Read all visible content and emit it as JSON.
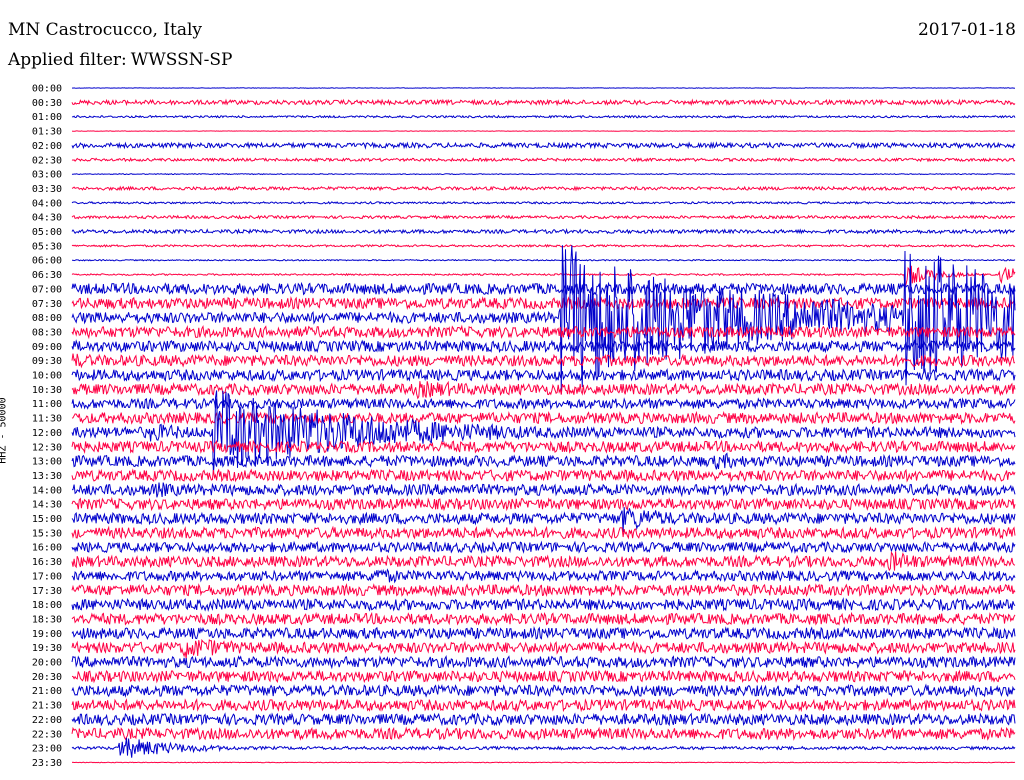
{
  "header": {
    "station": "MN Castrocucco, Italy",
    "date": "2017-01-18",
    "filter_label": "Applied filter:",
    "filter_value": "WWSSN-SP"
  },
  "chart_data": {
    "type": "line",
    "title": "MN Castrocucco, Italy",
    "date": "2017-01-18",
    "filter": "WWSSN-SP",
    "ylabel": "HHZ - 50000",
    "colors": [
      "#0000cc",
      "#ff0044"
    ],
    "row_labels": [
      "00:00",
      "00:30",
      "01:00",
      "01:30",
      "02:00",
      "02:30",
      "03:00",
      "03:30",
      "04:00",
      "04:30",
      "05:00",
      "05:30",
      "06:00",
      "06:30",
      "07:00",
      "07:30",
      "08:00",
      "08:30",
      "09:00",
      "09:30",
      "10:00",
      "10:30",
      "11:00",
      "11:30",
      "12:00",
      "12:30",
      "13:00",
      "13:30",
      "14:00",
      "14:30",
      "15:00",
      "15:30",
      "16:00",
      "16:30",
      "17:00",
      "17:30",
      "18:00",
      "18:30",
      "19:00",
      "19:30",
      "20:00",
      "20:30",
      "21:00",
      "21:30",
      "22:00",
      "22:30",
      "23:00",
      "23:30"
    ],
    "noise_amplitude": [
      0.2,
      2.2,
      1.0,
      0.2,
      2.4,
      1.4,
      0.4,
      1.6,
      1.0,
      1.4,
      1.8,
      1.0,
      0.6,
      0.8,
      5.5,
      5.5,
      5.5,
      5.5,
      5.5,
      5.5,
      5.5,
      5.5,
      5.0,
      5.5,
      5.5,
      5.5,
      5.5,
      5.5,
      5.5,
      5.5,
      5.5,
      5.5,
      5.0,
      5.5,
      5.0,
      5.5,
      5.5,
      5.5,
      5.5,
      5.5,
      5.5,
      5.5,
      5.5,
      5.5,
      5.5,
      5.5,
      1.5,
      0.3
    ],
    "events": [
      {
        "row": "06:30",
        "minute": 26.5,
        "amplitude": 12,
        "duration": 1
      },
      {
        "row": "06:30",
        "minute": 29.5,
        "amplitude": 8,
        "duration": 2.5
      },
      {
        "row": "09:30",
        "minute": 0,
        "amplitude": 8,
        "duration": 2
      },
      {
        "row": "10:30",
        "minute": 11,
        "amplitude": 9,
        "duration": 4
      },
      {
        "row": "12:00",
        "minute": 2.5,
        "amplitude": 10,
        "duration": 2
      },
      {
        "row": "13:00",
        "minute": 20.5,
        "amplitude": 9,
        "duration": 2
      },
      {
        "row": "14:00",
        "minute": 2.5,
        "amplitude": 9,
        "duration": 2
      },
      {
        "row": "15:00",
        "minute": 17.5,
        "amplitude": 14,
        "duration": 2
      },
      {
        "row": "16:30",
        "minute": 26,
        "amplitude": 12,
        "duration": 1.5
      },
      {
        "row": "17:00",
        "minute": 9.5,
        "amplitude": 9,
        "duration": 2
      },
      {
        "row": "19:30",
        "minute": 3.5,
        "amplitude": 12,
        "duration": 2.5
      },
      {
        "row": "23:00",
        "minute": 1.5,
        "amplitude": 12,
        "duration": 2
      },
      {
        "row": "12:00",
        "minute": 4.5,
        "amplitude": 45,
        "duration": 5
      },
      {
        "row": "08:00",
        "minute": 15.5,
        "amplitude": 80,
        "duration": 6
      },
      {
        "row": "08:00",
        "minute": 26.5,
        "amplitude": 80,
        "duration": 5
      }
    ]
  }
}
